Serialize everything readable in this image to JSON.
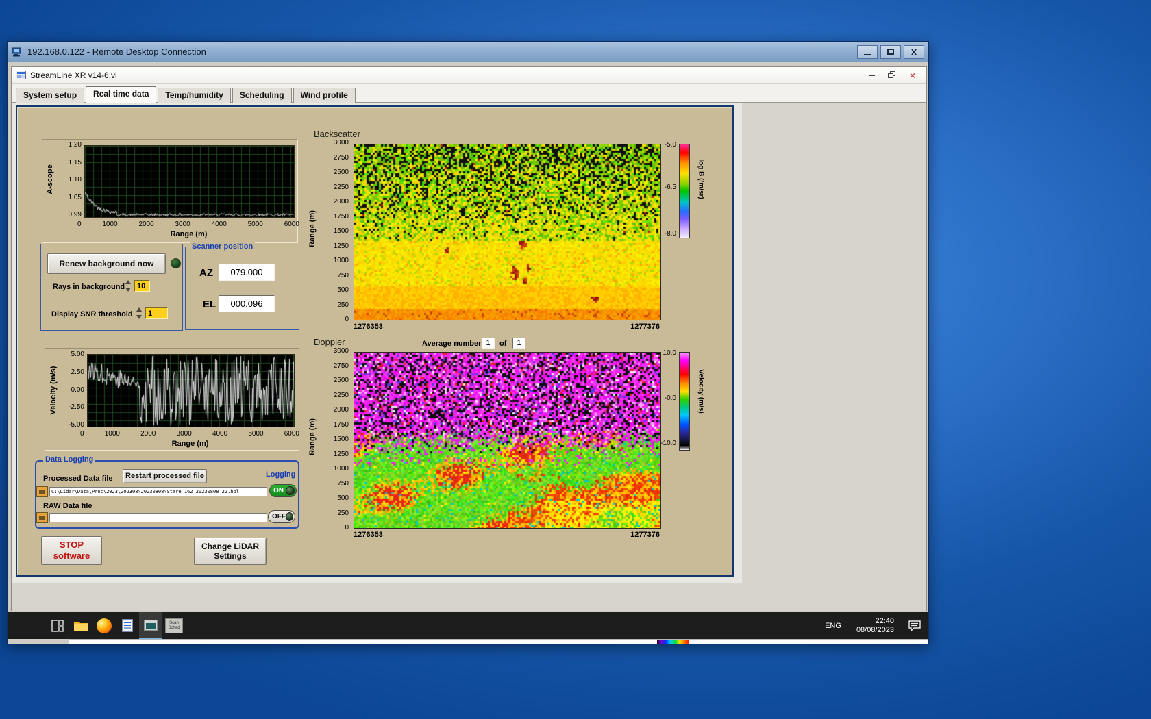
{
  "rdp": {
    "title": "192.168.0.122 - Remote Desktop Connection"
  },
  "app": {
    "title": "StreamLine XR v14-6.vi"
  },
  "tabs": {
    "items": [
      {
        "label": "System setup"
      },
      {
        "label": "Real time data"
      },
      {
        "label": "Temp/humidity"
      },
      {
        "label": "Scheduling"
      },
      {
        "label": "Wind profile"
      }
    ],
    "active_index": 1
  },
  "ascope": {
    "ylabel": "A-scope",
    "xlabel": "Range (m)",
    "yticks": [
      "1.20",
      "1.15",
      "1.10",
      "1.05",
      "0.99"
    ],
    "xticks": [
      "0",
      "1000",
      "2000",
      "3000",
      "4000",
      "5000",
      "6000"
    ]
  },
  "background_controls": {
    "renew_button": "Renew background now",
    "rays_label": "Rays in background",
    "rays_value": "10",
    "snr_label": "Display SNR threshold",
    "snr_value": "1"
  },
  "scanner": {
    "title": "Scanner position",
    "az_label": "AZ",
    "az_value": "079.000",
    "el_label": "EL",
    "el_value": "000.096"
  },
  "backscatter": {
    "title": "Backscatter",
    "ylabel": "Range (m)",
    "yticks": [
      "3000",
      "2750",
      "2500",
      "2250",
      "2000",
      "1750",
      "1500",
      "1250",
      "1000",
      "750",
      "500",
      "250",
      "0"
    ],
    "x_start": "1276353",
    "x_end": "1277376",
    "colorbar_label": "log B (/m/sr)",
    "colorbar_ticks": [
      "-5.0",
      "-6.5",
      "-8.0"
    ]
  },
  "doppler": {
    "title": "Doppler",
    "avg_label": "Average number",
    "avg_value": "1",
    "of_label": "of",
    "of_count": "1",
    "ylabel": "Range (m)",
    "yticks": [
      "3000",
      "2750",
      "2500",
      "2250",
      "2000",
      "1750",
      "1500",
      "1250",
      "1000",
      "750",
      "500",
      "250",
      "0"
    ],
    "x_start": "1276353",
    "x_end": "1277376",
    "colorbar_label": "Velocity (m/s)",
    "colorbar_ticks": [
      "10.0",
      "-0.0",
      "-10.0"
    ]
  },
  "velocity": {
    "ylabel": "Velocity (m/s)",
    "xlabel": "Range (m)",
    "yticks": [
      "5.00",
      "2.50",
      "0.00",
      "-2.50",
      "-5.00"
    ],
    "xticks": [
      "0",
      "1000",
      "2000",
      "3000",
      "4000",
      "5000",
      "6000"
    ]
  },
  "logging": {
    "title": "Data Logging",
    "processed_label": "Processed Data file",
    "restart_button": "Restart processed file",
    "logging_label": "Logging",
    "processed_path": "C:\\Lidar\\Data\\Proc\\2023\\202308\\20230808\\Stare_162_20230808_22.hpl",
    "processed_state": "ON",
    "raw_label": "RAW Data file",
    "raw_path": "",
    "raw_state": "OFF"
  },
  "footer_buttons": {
    "stop_line1": "STOP",
    "stop_line2": "software",
    "change_line1": "Change LiDAR",
    "change_line2": "Settings"
  },
  "taskbar": {
    "language": "ENG",
    "time": "22:40",
    "date": "08/08/2023",
    "scan_icon_line1": "Scan",
    "scan_icon_line2": "Sched"
  },
  "chart_data": [
    {
      "type": "line",
      "title": "A-scope",
      "ylabel": "A-scope",
      "xlabel": "Range (m)",
      "xlim": [
        0,
        6000
      ],
      "ylim": [
        0.99,
        1.2
      ],
      "description": "White noisy trace on black/green grid: starts near 1.06 at range 0, decays to ~1.00 by 800 m, then flat near 0.995-1.00 with small noise out to 6000 m"
    },
    {
      "type": "line",
      "title": "Velocity",
      "ylabel": "Velocity (m/s)",
      "xlabel": "Range (m)",
      "xlim": [
        0,
        6000
      ],
      "ylim": [
        -5,
        5
      ],
      "description": "Noisy white trace: 0-1500 m wanders between about +4 and -1 m/s; beyond ~1500 m random full-scale noise fills -5 to +5 m/s as dense vertical strokes"
    },
    {
      "type": "heatmap",
      "title": "Backscatter",
      "ylabel": "Range (m)",
      "ylim": [
        0,
        3000
      ],
      "x_start": 1276353,
      "x_end": 1277376,
      "colorbar_label": "log B (/m/sr)",
      "colorbar_ticks": [
        -5.0,
        -6.5,
        -8.0
      ],
      "description": "Bright orange/yellow returns below ~1000 m, speckled yellow-green 1000-2000 m, increasing black dropouts above 2000 m, isolated dark-red strong-return patches between ~500 and 1500 m"
    },
    {
      "type": "heatmap",
      "title": "Doppler",
      "ylabel": "Range (m)",
      "ylim": [
        0,
        3000
      ],
      "x_start": 1276353,
      "x_end": 1277376,
      "colorbar_label": "Velocity (m/s)",
      "colorbar_ticks": [
        10.0,
        -0.0,
        -10.0
      ],
      "description": "Magenta noise with black speckle above ~1600 m; coherent green/yellow/red diagonal velocity structures below ~1300 m with a red band in the lower-right"
    }
  ]
}
